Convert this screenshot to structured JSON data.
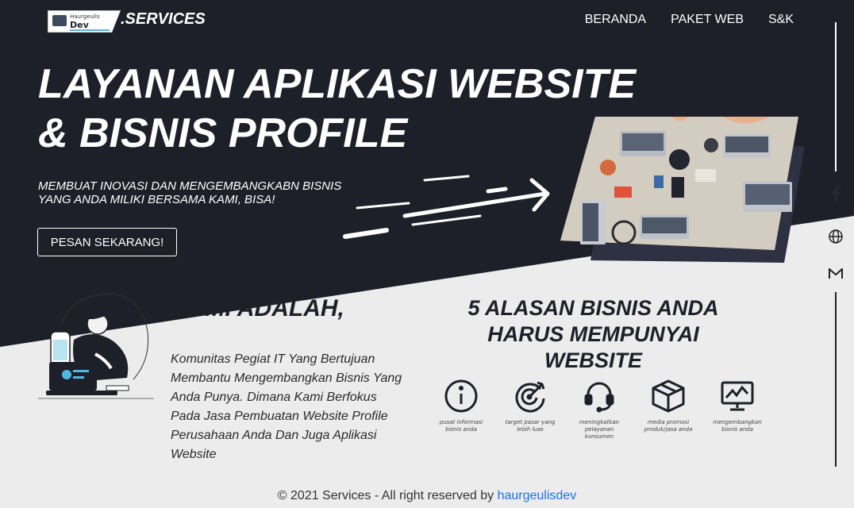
{
  "header": {
    "logo_line1": "Haurgeulis",
    "logo_line2": "Dev",
    "brand": ".SERVICES",
    "nav": [
      "BERANDA",
      "PAKET WEB",
      "S&K"
    ]
  },
  "hero": {
    "title_line1": "LAYANAN APLIKASI WEBSITE",
    "title_line2": "& BISNIS PROFILE",
    "subtitle_line1": "MEMBUAT INOVASI DAN MENGEMBANGKABN BISNIS",
    "subtitle_line2": "YANG ANDA MILIKI BERSAMA KAMI, BISA!",
    "cta_label": "PESAN SEKARANG!"
  },
  "sidebar": {
    "icons": [
      "facebook-icon",
      "globe-icon",
      "gmail-icon"
    ]
  },
  "about": {
    "title": "KAMI ADALAH,",
    "text": "Komunitas Pegiat IT Yang Bertujuan Membantu Mengembangkan Bisnis Yang Anda Punya. Dimana Kami Berfokus Pada Jasa Pembuatan Website Profile Perusahaan Anda Dan Juga Aplikasi Website"
  },
  "reasons": {
    "title_line1": "5 ALASAN BISNIS ANDA",
    "title_line2": "HARUS MEMPUNYAI",
    "title_line3": "WEBSITE",
    "items": [
      {
        "icon": "info-icon",
        "label_line1": "pusat informasi",
        "label_line2": "bisnis anda"
      },
      {
        "icon": "target-icon",
        "label_line1": "target pasar yang",
        "label_line2": "lebih luas"
      },
      {
        "icon": "headset-icon",
        "label_line1": "meningkatkan",
        "label_line2": "pelayanan konsumen"
      },
      {
        "icon": "box-icon",
        "label_line1": "media promosi",
        "label_line2": "produk/jasa anda"
      },
      {
        "icon": "presentation-chart-icon",
        "label_line1": "mengembangkan",
        "label_line2": "bisnis anda"
      }
    ]
  },
  "footer": {
    "text": "© 2021 Services - All right reserved by ",
    "link": "haurgeulisdev"
  },
  "colors": {
    "dark": "#1e2029",
    "light": "#ececed",
    "link": "#1a73e8"
  }
}
